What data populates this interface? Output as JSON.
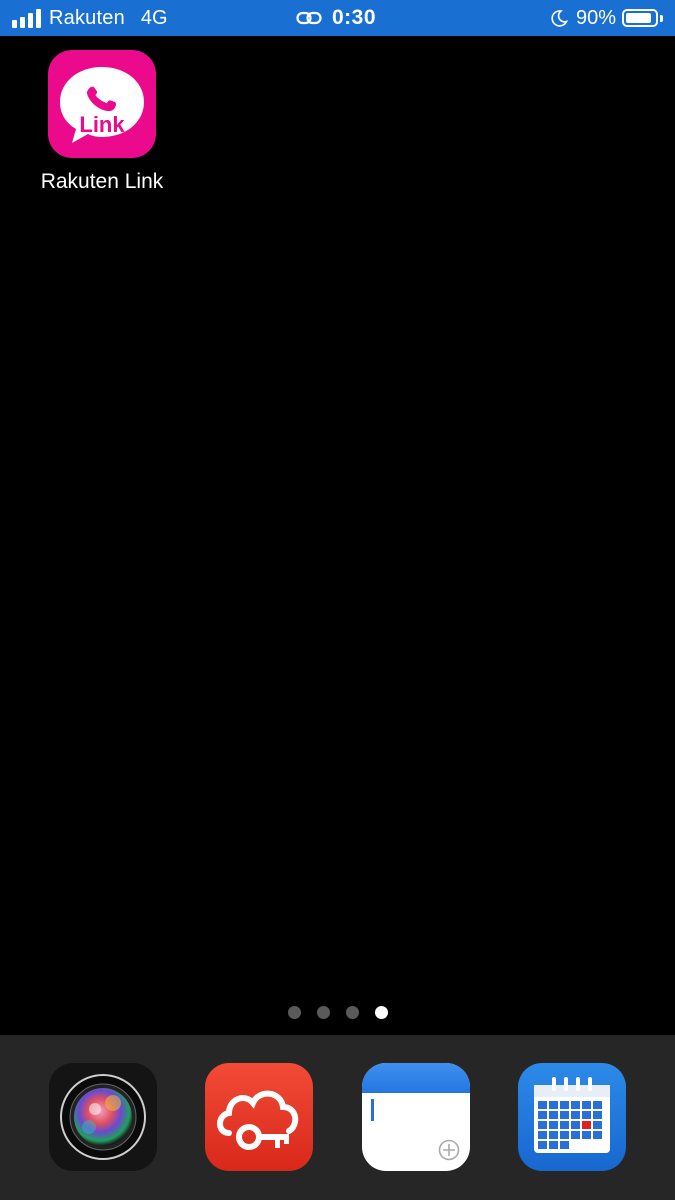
{
  "status_bar": {
    "carrier": "Rakuten",
    "network": "4G",
    "time": "0:30",
    "battery_percent": "90%",
    "battery_level": 0.9,
    "signal_bars": 4,
    "icons": [
      "signal-icon",
      "link-icon",
      "moon-icon",
      "battery-icon"
    ]
  },
  "home": {
    "apps": [
      {
        "label": "Rakuten Link",
        "icon": "rakuten-link-icon",
        "icon_text": "Link",
        "color": "#eb0a8c"
      }
    ]
  },
  "page_indicator": {
    "pages": 4,
    "current": 4
  },
  "dock": {
    "apps": [
      {
        "icon": "camera-app-icon"
      },
      {
        "icon": "cloud-key-app-icon",
        "color": "#e83a26"
      },
      {
        "icon": "notes-app-icon"
      },
      {
        "icon": "calendar-app-icon",
        "color": "#1f7ae0"
      }
    ]
  },
  "colors": {
    "status_bar": "#1a6fd3",
    "background": "#000000",
    "dock": "#262626"
  }
}
